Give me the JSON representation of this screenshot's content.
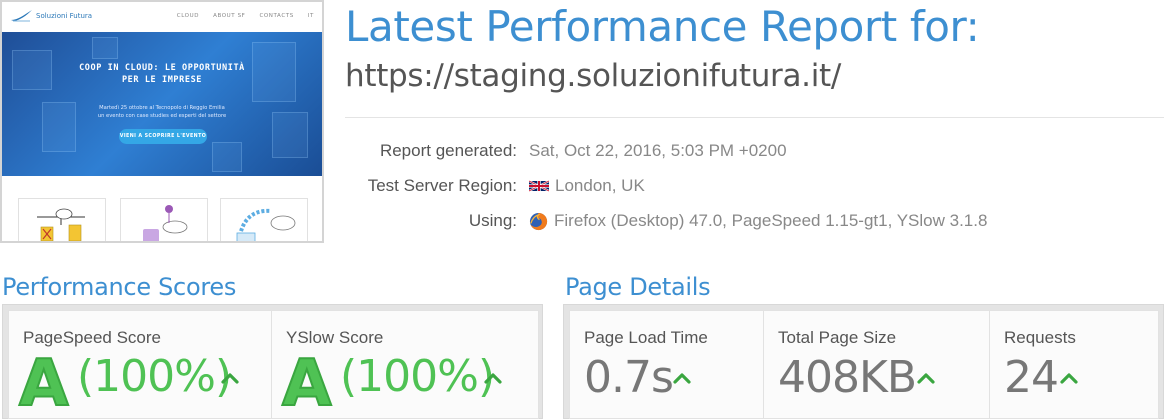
{
  "thumbnail": {
    "brand": "Soluzioni Futura",
    "nav": [
      "CLOUD",
      "ABOUT SF",
      "CONTACTS",
      "IT"
    ],
    "hero_title_lines": [
      "COOP IN CLOUD: LE OPPORTUNITÀ",
      "PER LE IMPRESE"
    ],
    "hero_sub_lines": [
      "Martedì 25 ottobre al Tecnopolo di Reggio Emilia",
      "un evento con case studies ed esperti del settore"
    ],
    "hero_button": "VIENI A SCOPRIRE L'EVENTO"
  },
  "report": {
    "title": "Latest Performance Report for:",
    "url": "https://staging.soluzionifutura.it/",
    "generated_label": "Report generated:",
    "generated_value": "Sat, Oct 22, 2016, 5:03 PM +0200",
    "region_label": "Test Server Region:",
    "region_value": "London, UK",
    "region_icon": "uk-flag-icon",
    "using_label": "Using:",
    "using_value": "Firefox (Desktop) 47.0, PageSpeed 1.15-gt1, YSlow 3.1.8",
    "using_icon": "firefox-icon"
  },
  "performance": {
    "title": "Performance Scores",
    "pagespeed": {
      "label": "PageSpeed Score",
      "grade": "A",
      "percent": "(100%)"
    },
    "yslow": {
      "label": "YSlow Score",
      "grade": "A",
      "percent": "(100%)"
    }
  },
  "details": {
    "title": "Page Details",
    "load_time": {
      "label": "Page Load Time",
      "value": "0.7s"
    },
    "page_size": {
      "label": "Total Page Size",
      "value": "408KB"
    },
    "requests": {
      "label": "Requests",
      "value": "24"
    }
  },
  "colors": {
    "accent_blue": "#3d8fd1",
    "grade_green": "#4fc254",
    "text_gray": "#555555"
  }
}
